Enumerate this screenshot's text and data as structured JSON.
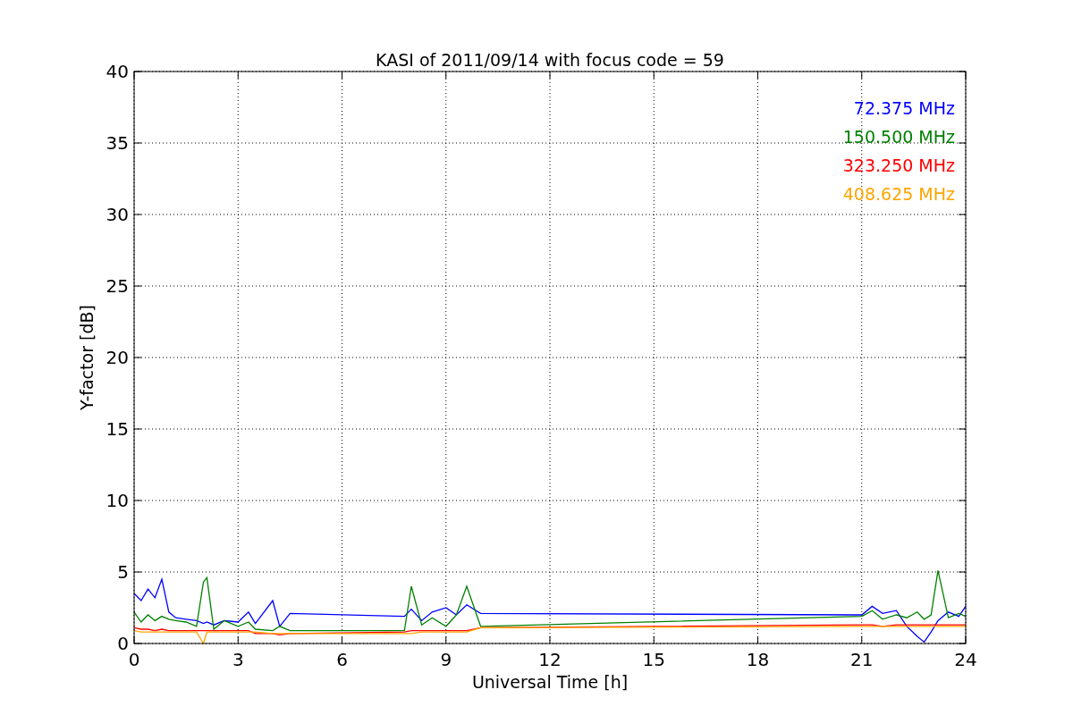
{
  "chart_data": {
    "type": "line",
    "title": "KASI of 2011/09/14 with focus code = 59",
    "xlabel": "Universal Time [h]",
    "ylabel": "Y-factor [dB]",
    "x": [
      0,
      0.2,
      0.4,
      0.6,
      0.8,
      1.0,
      1.2,
      1.5,
      1.8,
      2.0,
      2.1,
      2.3,
      2.6,
      3.0,
      3.3,
      3.5,
      4.0,
      4.2,
      4.5,
      7.8,
      8.0,
      8.3,
      8.6,
      9.0,
      9.3,
      9.6,
      10.0,
      21.0,
      21.3,
      21.6,
      22.0,
      22.3,
      22.6,
      22.8,
      23.0,
      23.2,
      23.5,
      23.8,
      24.0
    ],
    "series": [
      {
        "name": "72.375 MHz",
        "color": "#0000ff",
        "values": [
          3.5,
          3.0,
          3.8,
          3.2,
          4.5,
          2.2,
          1.8,
          1.7,
          1.6,
          1.4,
          1.5,
          1.3,
          1.6,
          1.5,
          2.2,
          1.4,
          3.0,
          1.2,
          2.1,
          1.9,
          2.4,
          1.6,
          2.2,
          2.5,
          2.0,
          2.7,
          2.1,
          2.0,
          2.6,
          2.1,
          2.3,
          1.2,
          0.5,
          0.1,
          0.8,
          1.6,
          2.2,
          1.9,
          2.6
        ]
      },
      {
        "name": "150.500 MHz",
        "color": "#008000",
        "values": [
          2.2,
          1.5,
          2.0,
          1.6,
          1.9,
          1.7,
          1.6,
          1.5,
          1.2,
          4.3,
          4.6,
          1.0,
          1.6,
          1.2,
          1.5,
          1.0,
          0.9,
          1.2,
          0.9,
          0.9,
          4.0,
          1.3,
          1.8,
          1.2,
          2.0,
          4.0,
          1.2,
          1.9,
          2.3,
          1.7,
          2.0,
          1.8,
          2.2,
          1.7,
          2.0,
          5.1,
          1.8,
          2.1,
          1.9
        ]
      },
      {
        "name": "323.250 MHz",
        "color": "#ff0000",
        "values": [
          1.1,
          1.0,
          1.0,
          0.9,
          1.0,
          0.9,
          0.9,
          0.9,
          0.9,
          0.9,
          0.9,
          0.9,
          0.9,
          0.9,
          0.9,
          0.7,
          0.7,
          0.6,
          0.7,
          0.8,
          0.9,
          0.9,
          0.9,
          0.9,
          0.9,
          0.9,
          1.1,
          1.3,
          1.3,
          1.2,
          1.3,
          1.3,
          1.3,
          1.3,
          1.3,
          1.3,
          1.3,
          1.3,
          1.3
        ]
      },
      {
        "name": "408.625 MHz",
        "color": "#ffa500",
        "values": [
          0.9,
          0.8,
          0.8,
          0.8,
          0.8,
          0.8,
          0.8,
          0.8,
          0.8,
          0.0,
          0.8,
          0.8,
          0.8,
          0.8,
          0.8,
          0.8,
          0.7,
          0.7,
          0.7,
          0.7,
          0.7,
          0.8,
          0.8,
          0.8,
          0.8,
          0.8,
          1.1,
          1.2,
          1.2,
          1.2,
          1.2,
          1.2,
          1.2,
          1.2,
          1.2,
          1.2,
          1.2,
          1.2,
          1.2
        ]
      }
    ],
    "grid": true,
    "xlim": [
      0,
      24
    ],
    "ylim": [
      0,
      40
    ],
    "xticks": [
      0,
      3,
      6,
      9,
      12,
      15,
      18,
      21,
      24
    ],
    "yticks": [
      0,
      5,
      10,
      15,
      20,
      25,
      30,
      35,
      40
    ]
  }
}
